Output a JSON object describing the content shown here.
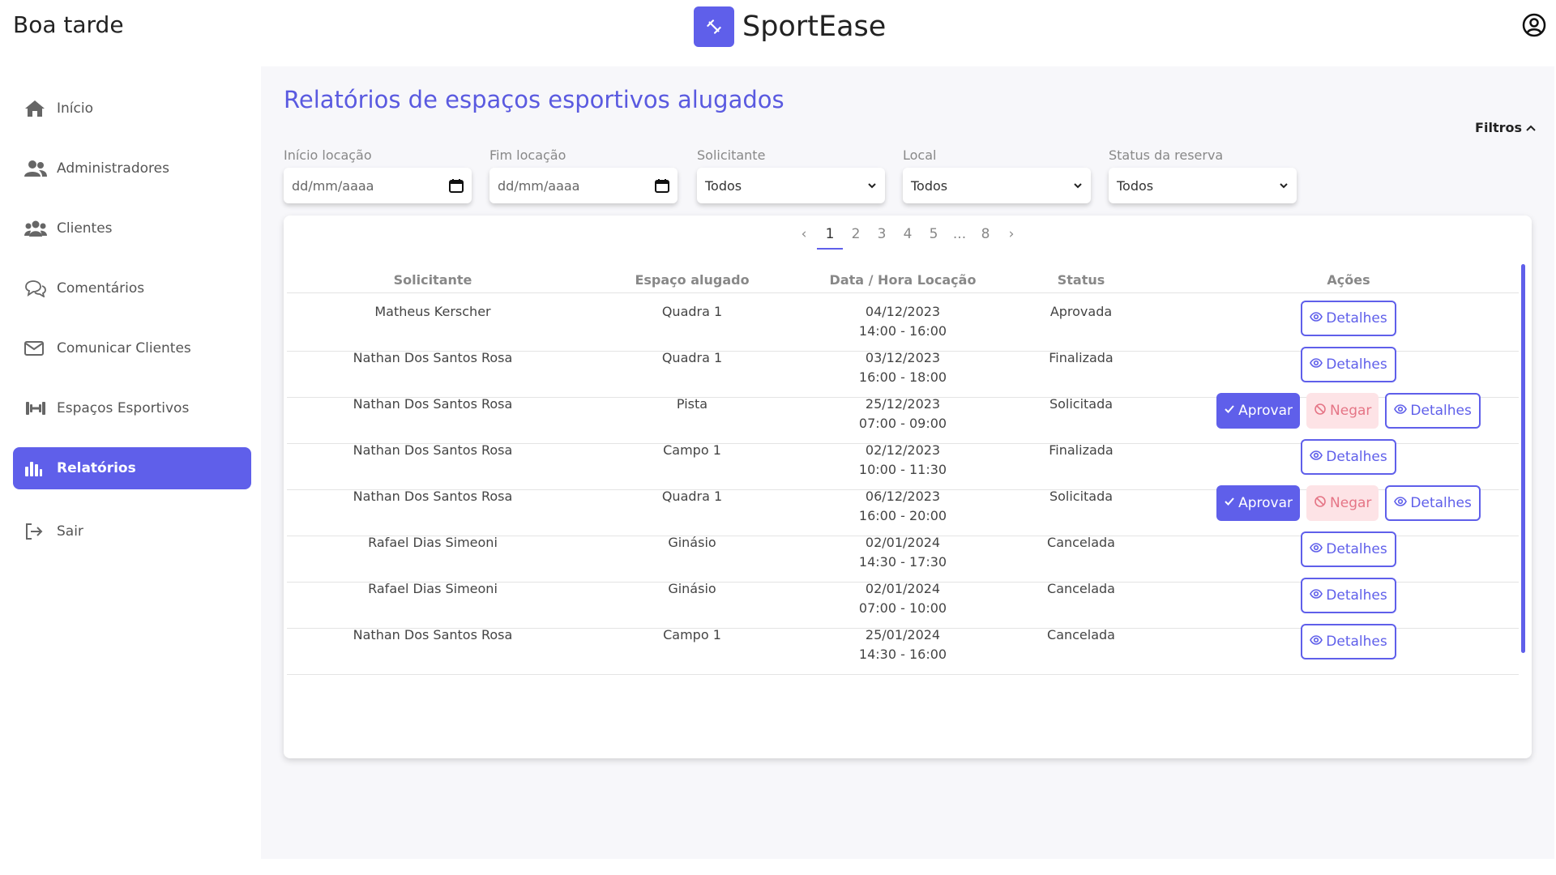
{
  "header": {
    "greeting": "Boa tarde",
    "brand": "SportEase"
  },
  "sidebar": {
    "items": [
      {
        "label": "Início",
        "icon": "home-icon"
      },
      {
        "label": "Administradores",
        "icon": "users-icon"
      },
      {
        "label": "Clientes",
        "icon": "group-icon"
      },
      {
        "label": "Comentários",
        "icon": "comments-icon"
      },
      {
        "label": "Comunicar Clientes",
        "icon": "envelope-icon"
      },
      {
        "label": "Espaços Esportivos",
        "icon": "dumbbell-icon"
      },
      {
        "label": "Relatórios",
        "icon": "chart-bar-icon",
        "active": true
      },
      {
        "label": "Sair",
        "icon": "logout-icon"
      }
    ]
  },
  "main": {
    "title": "Relatórios de espaços esportivos alugados",
    "filters_label": "Filtros",
    "filters": {
      "start_label": "Início locação",
      "start_placeholder": "dd/mm/aaaa",
      "end_label": "Fim locação",
      "end_placeholder": "dd/mm/aaaa",
      "requester_label": "Solicitante",
      "requester_value": "Todos",
      "place_label": "Local",
      "place_value": "Todos",
      "status_label": "Status da reserva",
      "status_value": "Todos"
    },
    "pagination": {
      "prev": "‹",
      "pages": [
        "1",
        "2",
        "3",
        "4",
        "5",
        "...",
        "8"
      ],
      "next": "›",
      "current": "1"
    },
    "table": {
      "headers": [
        "Solicitante",
        "Espaço alugado",
        "Data / Hora Locação",
        "Status",
        "Ações"
      ],
      "rows": [
        {
          "requester": "Matheus Kerscher",
          "space": "Quadra 1",
          "date": "04/12/2023",
          "time": "14:00 - 16:00",
          "status": "Aprovada"
        },
        {
          "requester": "Nathan Dos Santos Rosa",
          "space": "Quadra 1",
          "date": "03/12/2023",
          "time": "16:00 - 18:00",
          "status": "Finalizada"
        },
        {
          "requester": "Nathan Dos Santos Rosa",
          "space": "Pista",
          "date": "25/12/2023",
          "time": "07:00 - 09:00",
          "status": "Solicitada"
        },
        {
          "requester": "Nathan Dos Santos Rosa",
          "space": "Campo 1",
          "date": "02/12/2023",
          "time": "10:00 - 11:30",
          "status": "Finalizada"
        },
        {
          "requester": "Nathan Dos Santos Rosa",
          "space": "Quadra 1",
          "date": "06/12/2023",
          "time": "16:00 - 20:00",
          "status": "Solicitada"
        },
        {
          "requester": "Rafael Dias Simeoni",
          "space": "Ginásio",
          "date": "02/01/2024",
          "time": "14:30 - 17:30",
          "status": "Cancelada"
        },
        {
          "requester": "Rafael Dias Simeoni",
          "space": "Ginásio",
          "date": "02/01/2024",
          "time": "07:00 - 10:00",
          "status": "Cancelada"
        },
        {
          "requester": "Nathan Dos Santos Rosa",
          "space": "Campo 1",
          "date": "25/01/2024",
          "time": "14:30 - 16:00",
          "status": "Cancelada"
        }
      ],
      "actions": {
        "approve": "Aprovar",
        "deny": "Negar",
        "details": "Detalhes"
      }
    }
  },
  "colors": {
    "accent": "#5f5fea",
    "deny_bg": "#fde3e6",
    "deny_text": "#e57586"
  }
}
